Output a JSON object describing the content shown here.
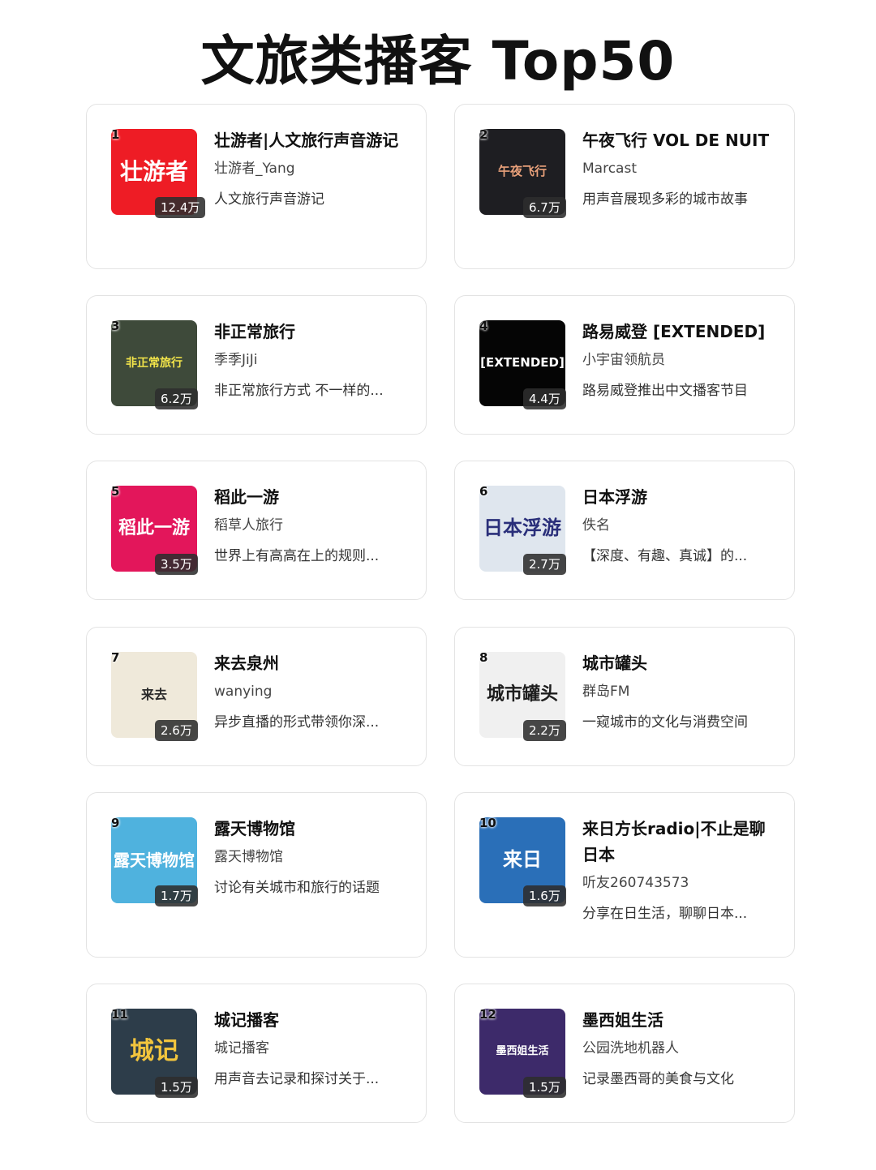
{
  "page": {
    "title": "文旅类播客 Top50"
  },
  "podcasts": [
    {
      "rank": "1",
      "plays": "12.4万",
      "title": "壮游者|人文旅行声音游记",
      "author": "壮游者_Yang",
      "desc": "人文旅行声音游记",
      "cover_text": "壮游者",
      "cover_bg": "#ee1c25",
      "cover_fg": "#ffffff"
    },
    {
      "rank": "2",
      "plays": "6.7万",
      "title": "午夜飞行 VOL DE NUIT",
      "author": "Marcast",
      "desc": "用声音展现多彩的城市故事",
      "cover_text": "午夜飞行",
      "cover_bg": "#1e1e22",
      "cover_fg": "#e8a07a"
    },
    {
      "rank": "3",
      "plays": "6.2万",
      "title": "非正常旅行",
      "author": "季季JiJi",
      "desc": "非正常旅行方式 不一样的...",
      "cover_text": "非正常旅行",
      "cover_bg": "#3e4a3a",
      "cover_fg": "#f2e44a"
    },
    {
      "rank": "4",
      "plays": "4.4万",
      "title": "路易威登 [EXTENDED]",
      "author": "小宇宙领航员",
      "desc": "路易威登推出中文播客节目",
      "cover_text": "[EXTENDED]",
      "cover_bg": "#050505",
      "cover_fg": "#ffffff"
    },
    {
      "rank": "5",
      "plays": "3.5万",
      "title": "稻此一游",
      "author": "稻草人旅行",
      "desc": "世界上有高高在上的规则...",
      "cover_text": "稻此一游",
      "cover_bg": "#e3165b",
      "cover_fg": "#ffffff"
    },
    {
      "rank": "6",
      "plays": "2.7万",
      "title": "日本浮游",
      "author": "佚名",
      "desc": "【深度、有趣、真诚】的...",
      "cover_text": "日本浮游",
      "cover_bg": "#dfe6ee",
      "cover_fg": "#2a2f7a"
    },
    {
      "rank": "7",
      "plays": "2.6万",
      "title": "来去泉州",
      "author": "wanying",
      "desc": "异步直播的形式带领你深...",
      "cover_text": "来去",
      "cover_bg": "#efe9da",
      "cover_fg": "#2b2b2b"
    },
    {
      "rank": "8",
      "plays": "2.2万",
      "title": "城市罐头",
      "author": "群岛FM",
      "desc": "一窥城市的文化与消费空间",
      "cover_text": "城市罐头",
      "cover_bg": "#f0f0f0",
      "cover_fg": "#1d1d1d"
    },
    {
      "rank": "9",
      "plays": "1.7万",
      "title": "露天博物馆",
      "author": "露天博物馆",
      "desc": "讨论有关城市和旅行的话题",
      "cover_text": "露天博物馆",
      "cover_bg": "#4fb2de",
      "cover_fg": "#ffffff"
    },
    {
      "rank": "10",
      "plays": "1.6万",
      "title": "来日方长radio|不止是聊日本",
      "author": "听友260743573",
      "desc": "分享在日生活，聊聊日本...",
      "cover_text": "来日",
      "cover_bg": "#2a6fb8",
      "cover_fg": "#ffffff"
    },
    {
      "rank": "11",
      "plays": "1.5万",
      "title": "城记播客",
      "author": "城记播客",
      "desc": "用声音去记录和探讨关于...",
      "cover_text": "城记",
      "cover_bg": "#2d3d4a",
      "cover_fg": "#f2c53d"
    },
    {
      "rank": "12",
      "plays": "1.5万",
      "title": "墨西姐生活",
      "author": "公园洗地机器人",
      "desc": "记录墨西哥的美食与文化",
      "cover_text": "墨西姐生活",
      "cover_bg": "#3d2a6a",
      "cover_fg": "#ffffff"
    }
  ]
}
